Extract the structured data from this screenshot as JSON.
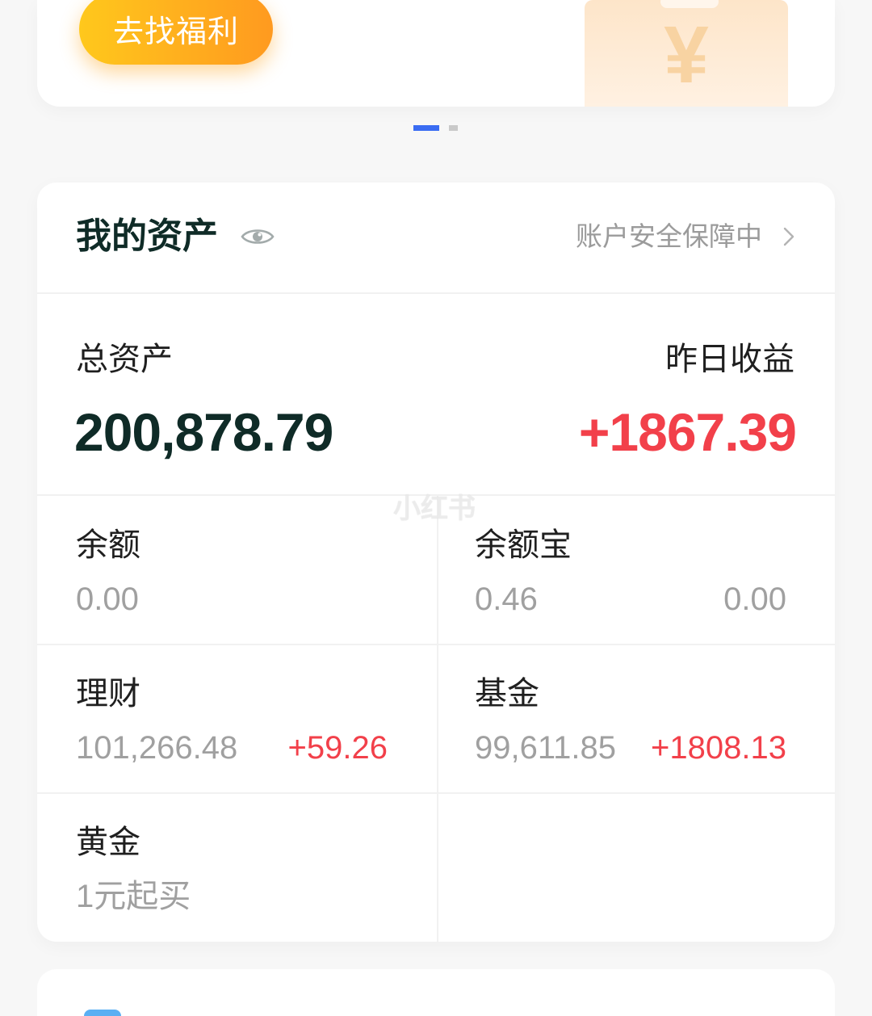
{
  "banner": {
    "button_label": "去找福利",
    "illustration_icon": "yen-coin-illustration",
    "illustration_glyph": "¥"
  },
  "carousel": {
    "count": 2,
    "active_index": 0
  },
  "assets": {
    "title": "我的资产",
    "visibility_icon": "eye-icon",
    "security_text": "账户安全保障中",
    "security_icon": "chevron-right-icon",
    "total_label": "总资产",
    "total_value": "200,878.79",
    "yesterday_label": "昨日收益",
    "yesterday_value": "+1867.39",
    "items": [
      {
        "label": "余额",
        "value": "0.00"
      },
      {
        "label": "余额宝",
        "value": "0.46",
        "extra": "0.00"
      },
      {
        "label": "理财",
        "value": "101,266.48",
        "extra": "+59.26"
      },
      {
        "label": "基金",
        "value": "99,611.85",
        "extra": "+1808.13"
      },
      {
        "label": "黄金",
        "value": "1元起买"
      }
    ]
  },
  "watermark": "小红书",
  "colors": {
    "accent_blue": "#3a6cf2",
    "button_orange_start": "#ffc81c",
    "button_orange_end": "#ff9a1f",
    "title_dark": "#0f2b27",
    "gain_red": "#f2404a",
    "muted_gray": "#a0a0a0"
  }
}
